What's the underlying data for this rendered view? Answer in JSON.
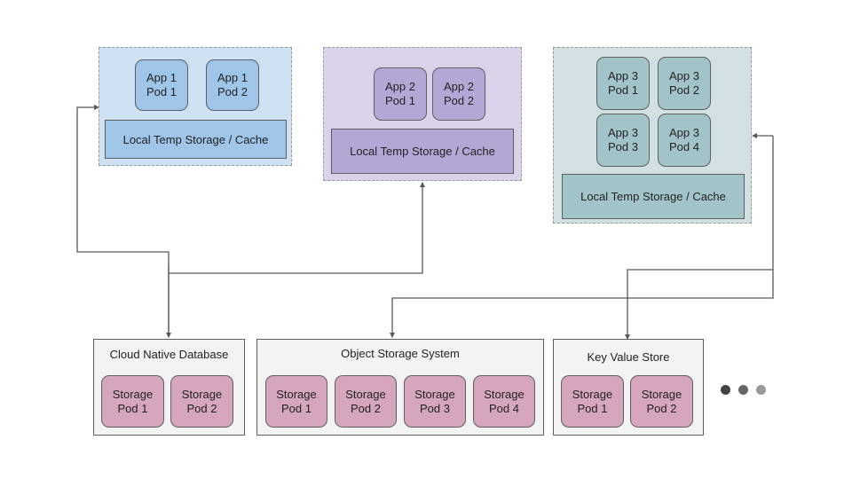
{
  "app_groups": [
    {
      "name": "App 1",
      "bg": "#cfe2f3",
      "pod_color": "#9fc5e8",
      "pods": [
        [
          "App 1",
          "Pod 1"
        ],
        [
          "App 1",
          "Pod 2"
        ]
      ],
      "cache_label": "Local Temp Storage / Cache"
    },
    {
      "name": "App 2",
      "bg": "#d9d2e9",
      "pod_color": "#b4a7d6",
      "pods": [
        [
          "App 2",
          "Pod 1"
        ],
        [
          "App 2",
          "Pod 2"
        ]
      ],
      "cache_label": "Local Temp Storage / Cache"
    },
    {
      "name": "App 3",
      "bg": "#d0e0e3",
      "pod_color": "#a2c4c9",
      "pods": [
        [
          "App 3",
          "Pod 1"
        ],
        [
          "App 3",
          "Pod 2"
        ],
        [
          "App 3",
          "Pod 3"
        ],
        [
          "App 3",
          "Pod 4"
        ]
      ],
      "cache_label": "Local Temp Storage / Cache"
    }
  ],
  "storage_systems": [
    {
      "title": "Cloud Native Database",
      "pods": [
        [
          "Storage",
          "Pod 1"
        ],
        [
          "Storage",
          "Pod 2"
        ]
      ]
    },
    {
      "title": "Object Storage System",
      "pods": [
        [
          "Storage",
          "Pod 1"
        ],
        [
          "Storage",
          "Pod 2"
        ],
        [
          "Storage",
          "Pod 3"
        ],
        [
          "Storage",
          "Pod 4"
        ]
      ]
    },
    {
      "title": "Key Value Store",
      "pods": [
        [
          "Storage",
          "Pod 1"
        ],
        [
          "Storage",
          "Pod 2"
        ]
      ]
    }
  ],
  "ellipsis": {
    "dot_colors": [
      "#434343",
      "#666666",
      "#999999"
    ]
  },
  "colors": {
    "line": "#595959",
    "storage_pod": "#d5a6bd",
    "storage_bg": "#f3f3f3"
  }
}
